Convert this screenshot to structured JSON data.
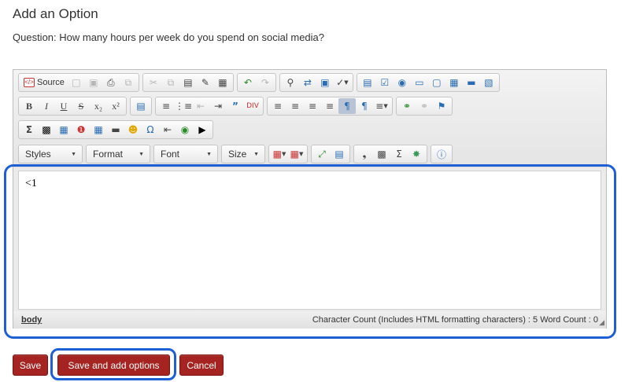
{
  "page": {
    "title": "Add an Option",
    "question": "Question: How many hours per week do you spend on social media?"
  },
  "toolbar": {
    "source_label": "Source",
    "styles_label": "Styles",
    "format_label": "Format",
    "font_label": "Font",
    "size_label": "Size"
  },
  "editor": {
    "content": "<1",
    "path_label": "body",
    "count_text": "Character Count (Includes HTML formatting characters) : 5 Word Count : 0"
  },
  "actions": {
    "save_label": "Save",
    "save_add_label": "Save and add options",
    "cancel_label": "Cancel"
  },
  "colors": {
    "button_bg": "#a52421",
    "highlight": "#1f5fd6"
  }
}
